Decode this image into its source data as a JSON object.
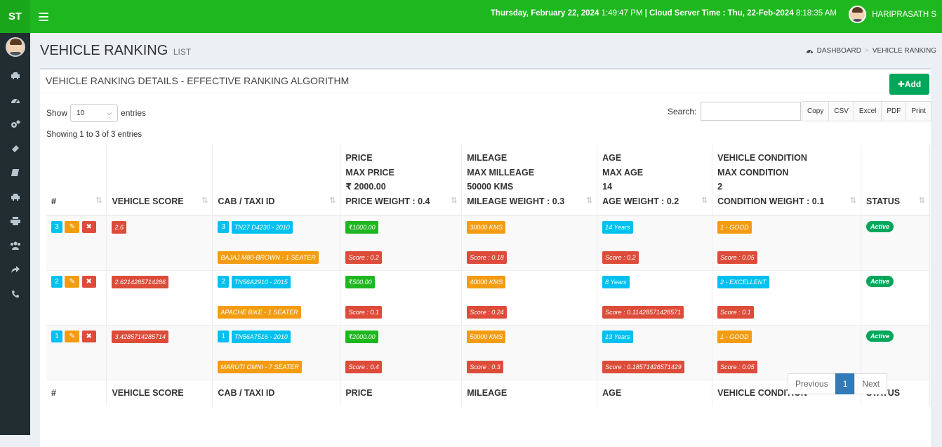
{
  "brand": "ST",
  "top": {
    "date": "Thursday, February 22, 2024",
    "time": "1:49:47 PM",
    "sep": "|",
    "server_label": "Cloud Server Time : Thu, 22-Feb-2024",
    "server_time": "8:18:35 AM",
    "user": "HARIPRASATH S"
  },
  "page": {
    "title": "VEHICLE RANKING",
    "subtitle": "LIST"
  },
  "breadcrumb": {
    "home": "DASHBOARD",
    "sep": ">",
    "current": "VEHICLE RANKING"
  },
  "box": {
    "title": "VEHICLE RANKING DETAILS - EFFECTIVE RANKING ALGORITHM",
    "add": "Add"
  },
  "controls": {
    "show": "Show",
    "entries_value": "10",
    "entries": "entries",
    "search": "Search:",
    "copy": "Copy",
    "csv": "CSV",
    "excel": "Excel",
    "pdf": "PDF",
    "print": "Print",
    "showing": "Showing 1 to 3 of 3 entries"
  },
  "head": {
    "num": "#",
    "score": "VEHICLE SCORE",
    "cab": "CAB / TAXI ID",
    "price": [
      "PRICE",
      "MAX PRICE",
      "₹ 2000.00",
      "PRICE WEIGHT : 0.4"
    ],
    "mileage": [
      "MILEAGE",
      "MAX MILLEAGE",
      "50000 KMS",
      "MILEAGE WEIGHT : 0.3"
    ],
    "age": [
      "AGE",
      "MAX AGE",
      "14",
      "AGE WEIGHT : 0.2"
    ],
    "condition": [
      "VEHICLE CONDITION",
      "MAX CONDITION",
      "2",
      "CONDITION WEIGHT : 0.1"
    ],
    "status": "STATUS"
  },
  "foot": {
    "num": "#",
    "score": "VEHICLE SCORE",
    "cab": "CAB / TAXI ID",
    "price": "PRICE",
    "mileage": "MILEAGE",
    "age": "AGE",
    "condition": "VEHICLE CONDITION",
    "status": "STATUS"
  },
  "rows": [
    {
      "rank": "3",
      "score": "2.6",
      "cab_no": "3",
      "cab_id": "TN27 D4230 - 2010",
      "model": "BAJAJ M80-BROWN - 1 SEATER",
      "price": "₹1000.00",
      "price_score": "Score : 0.2",
      "mileage": "30000 KMS",
      "mileage_score": "Score : 0.18",
      "age": "14 Years",
      "age_score": "Score : 0.2",
      "condition": "1 - GOOD",
      "condition_score": "Score : 0.05",
      "status": "Active"
    },
    {
      "rank": "2",
      "score": "2.6214285714286",
      "cab_no": "2",
      "cab_id": "TN56A2910 - 2015",
      "model": "APACHE BIKE - 1 SEATER",
      "price": "₹500.00",
      "price_score": "Score : 0.1",
      "mileage": "40000 KMS",
      "mileage_score": "Score : 0.24",
      "age": "8 Years",
      "age_score": "Score : 0.11428571428571",
      "condition": "2 - EXCELLENT",
      "condition_score": "Score : 0.1",
      "status": "Active"
    },
    {
      "rank": "1",
      "score": "3.4285714285714",
      "cab_no": "1",
      "cab_id": "TN56A7516 - 2010",
      "model": "MARUTI OMNI - 7 SEATER",
      "price": "₹2000.00",
      "price_score": "Score : 0.4",
      "mileage": "50000 KMS",
      "mileage_score": "Score : 0.3",
      "age": "13 Years",
      "age_score": "Score : 0.18571428571429",
      "condition": "1 - GOOD",
      "condition_score": "Score : 0.05",
      "status": "Active"
    }
  ],
  "pager": {
    "prev": "Previous",
    "page": "1",
    "next": "Next"
  },
  "icons": {
    "menu": "menu-icon",
    "edit": "edit-icon",
    "delete": "delete-icon",
    "plus": "plus-icon",
    "dashboard": "dashboard-icon",
    "sort": "sort-icon"
  },
  "colors": {
    "topbar": "#1fb71f",
    "sidebar": "#222d32",
    "red": "#dd4b39",
    "blue": "#00c0ef",
    "orange": "#f39c12",
    "green": "#00a65a"
  }
}
